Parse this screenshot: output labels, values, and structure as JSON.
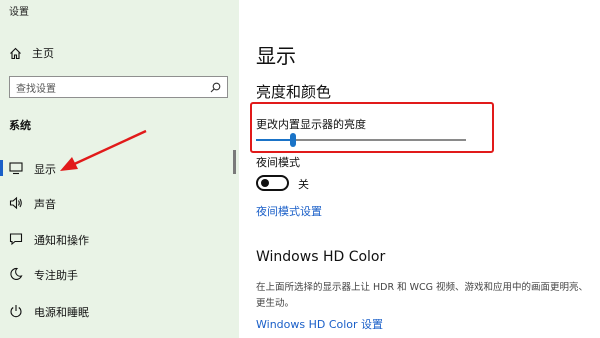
{
  "window": {
    "title": "设置"
  },
  "sidebar": {
    "home_label": "主页",
    "search_placeholder": "查找设置",
    "section_label": "系统",
    "items": [
      {
        "label": "显示",
        "icon": "monitor-icon",
        "active": true
      },
      {
        "label": "声音",
        "icon": "speaker-icon"
      },
      {
        "label": "通知和操作",
        "icon": "notification-icon"
      },
      {
        "label": "专注助手",
        "icon": "moon-icon"
      },
      {
        "label": "电源和睡眠",
        "icon": "power-icon"
      }
    ]
  },
  "main": {
    "page_title": "显示",
    "section_title": "亮度和颜色",
    "brightness": {
      "label": "更改内置显示器的亮度",
      "value": 0.16
    },
    "night_light": {
      "label": "夜间模式",
      "toggle_state": "关",
      "settings_link": "夜间模式设置"
    },
    "hd_color": {
      "title": "Windows HD Color",
      "description": "在上面所选择的显示器上让 HDR 和 WCG 视频、游戏和应用中的画面更明亮、更生动。",
      "link": "Windows HD Color 设置"
    }
  },
  "colors": {
    "sidebar_bg": "#e9f3e6",
    "accent": "#1a73c7",
    "annotation_red": "#e11a1a"
  }
}
